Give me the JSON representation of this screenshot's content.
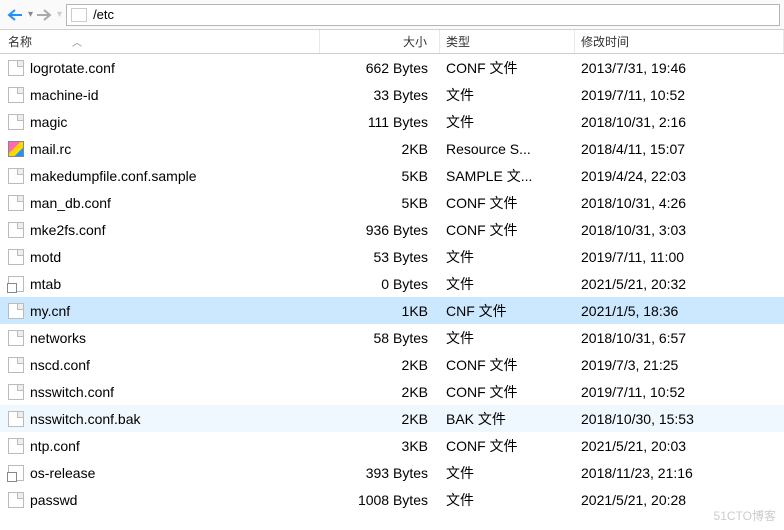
{
  "toolbar": {
    "path": "/etc"
  },
  "headers": {
    "name": "名称",
    "size": "大小",
    "type": "类型",
    "date": "修改时间"
  },
  "files": [
    {
      "name": "logrotate.conf",
      "size": "662 Bytes",
      "type": "CONF 文件",
      "date": "2013/7/31, 19:46",
      "icon": "generic",
      "row": "normal"
    },
    {
      "name": "machine-id",
      "size": "33 Bytes",
      "type": "文件",
      "date": "2019/7/11, 10:52",
      "icon": "generic",
      "row": "normal"
    },
    {
      "name": "magic",
      "size": "111 Bytes",
      "type": "文件",
      "date": "2018/10/31, 2:16",
      "icon": "generic",
      "row": "normal"
    },
    {
      "name": "mail.rc",
      "size": "2KB",
      "type": "Resource S...",
      "date": "2018/4/11, 15:07",
      "icon": "resource",
      "row": "normal"
    },
    {
      "name": "makedumpfile.conf.sample",
      "size": "5KB",
      "type": "SAMPLE 文...",
      "date": "2019/4/24, 22:03",
      "icon": "generic",
      "row": "normal"
    },
    {
      "name": "man_db.conf",
      "size": "5KB",
      "type": "CONF 文件",
      "date": "2018/10/31, 4:26",
      "icon": "generic",
      "row": "normal"
    },
    {
      "name": "mke2fs.conf",
      "size": "936 Bytes",
      "type": "CONF 文件",
      "date": "2018/10/31, 3:03",
      "icon": "generic",
      "row": "normal"
    },
    {
      "name": "motd",
      "size": "53 Bytes",
      "type": "文件",
      "date": "2019/7/11, 11:00",
      "icon": "generic",
      "row": "normal"
    },
    {
      "name": "mtab",
      "size": "0 Bytes",
      "type": "文件",
      "date": "2021/5/21, 20:32",
      "icon": "link",
      "row": "normal"
    },
    {
      "name": "my.cnf",
      "size": "1KB",
      "type": "CNF 文件",
      "date": "2021/1/5, 18:36",
      "icon": "generic",
      "row": "selected"
    },
    {
      "name": "networks",
      "size": "58 Bytes",
      "type": "文件",
      "date": "2018/10/31, 6:57",
      "icon": "generic",
      "row": "normal"
    },
    {
      "name": "nscd.conf",
      "size": "2KB",
      "type": "CONF 文件",
      "date": "2019/7/3, 21:25",
      "icon": "generic",
      "row": "normal"
    },
    {
      "name": "nsswitch.conf",
      "size": "2KB",
      "type": "CONF 文件",
      "date": "2019/7/11, 10:52",
      "icon": "generic",
      "row": "normal"
    },
    {
      "name": "nsswitch.conf.bak",
      "size": "2KB",
      "type": "BAK 文件",
      "date": "2018/10/30, 15:53",
      "icon": "generic",
      "row": "odd"
    },
    {
      "name": "ntp.conf",
      "size": "3KB",
      "type": "CONF 文件",
      "date": "2021/5/21, 20:03",
      "icon": "generic",
      "row": "normal"
    },
    {
      "name": "os-release",
      "size": "393 Bytes",
      "type": "文件",
      "date": "2018/11/23, 21:16",
      "icon": "link",
      "row": "normal"
    },
    {
      "name": "passwd",
      "size": "1008 Bytes",
      "type": "文件",
      "date": "2021/5/21, 20:28",
      "icon": "generic",
      "row": "normal"
    }
  ],
  "watermark": "51CTO博客"
}
